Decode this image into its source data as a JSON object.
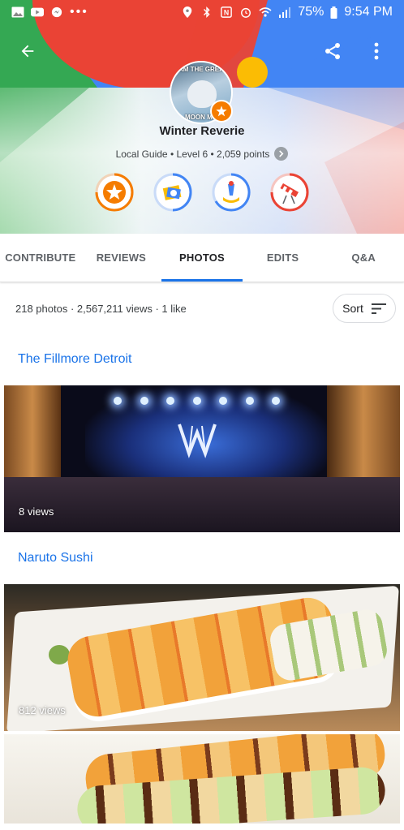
{
  "status_bar": {
    "left_icons": [
      "gallery-icon",
      "youtube-icon",
      "messenger-icon",
      "more-dots-icon"
    ],
    "right_icons": [
      "location-icon",
      "bluetooth-icon",
      "nfc-icon",
      "alarm-icon",
      "wifi-icon",
      "signal-icon",
      "battery-icon"
    ],
    "battery": "75%",
    "time": "9:54 PM"
  },
  "header": {
    "back_icon": "arrow-left-icon",
    "share_icon": "share-icon",
    "more_icon": "more-vert-icon",
    "avatar_meme_top": "I AM THE GREAT",
    "avatar_meme_bottom": "MOON MO",
    "name": "Winter Reverie",
    "guide_info": "Local Guide • Level 6 • 2,059 points",
    "badges": [
      {
        "name": "local-guide-badge",
        "color": "#f57c00"
      },
      {
        "name": "photographer-badge",
        "color": "#4285f4"
      },
      {
        "name": "reviewer-badge",
        "color": "#4285f4"
      },
      {
        "name": "explorer-badge",
        "color": "#ea4335"
      }
    ],
    "colors": {
      "red": "#ea4335",
      "green": "#34a853",
      "blue": "#4285f4",
      "yellow": "#fbbc04"
    }
  },
  "tabs": [
    {
      "label": "CONTRIBUTE",
      "active": false
    },
    {
      "label": "REVIEWS",
      "active": false
    },
    {
      "label": "PHOTOS",
      "active": true
    },
    {
      "label": "EDITS",
      "active": false
    },
    {
      "label": "Q&A",
      "active": false
    }
  ],
  "summary": {
    "stats": "218 photos · 2,567,211 views · 1 like",
    "sort_label": "Sort"
  },
  "places": [
    {
      "title": "The Fillmore Detroit",
      "photos": [
        {
          "views": "8 views"
        }
      ]
    },
    {
      "title": "Naruto Sushi",
      "photos": [
        {
          "views": "812 views"
        },
        {
          "views": ""
        }
      ]
    }
  ]
}
